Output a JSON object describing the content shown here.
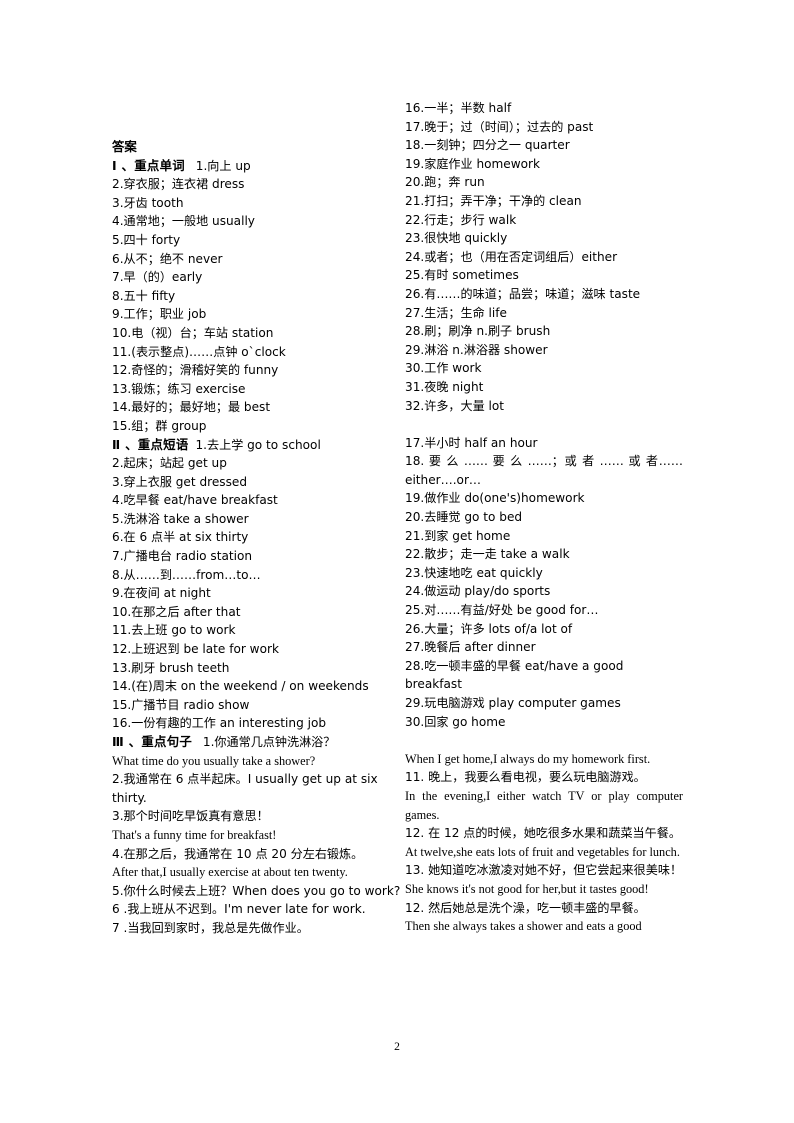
{
  "document": {
    "page_number": "2",
    "title": "答案"
  },
  "left_column": {
    "heading": "答案",
    "sections": [
      {
        "label": "Ⅰ 、重点单词",
        "first_item": "1.向上 up"
      }
    ],
    "lines": [
      "2.穿衣服；连衣裙 dress",
      "3.牙齿 tooth",
      "4.通常地；一般地 usually",
      "5.四十 forty",
      "6.从不；绝不 never",
      "7.早（的）early",
      "8.五十 fifty",
      "9.工作；职业 job",
      "10.电（视）台；车站 station",
      "11.(表示整点)……点钟 o`clock",
      "12.奇怪的；滑稽好笑的 funny",
      "13.锻炼；练习 exercise",
      "14.最好的；最好地；最 best",
      "15.组；群 group"
    ],
    "section2": {
      "label": "Ⅱ 、重点短语",
      "first_item": "1.去上学 go to school",
      "lines": [
        "2.起床；站起 get up",
        "3.穿上衣服 get dressed",
        "4.吃早餐 eat/have breakfast",
        "5.洗淋浴 take a shower",
        "6.在 6 点半 at six thirty",
        "7.广播电台 radio station",
        "8.从……到……from…to…",
        "9.在夜间 at night",
        "10.在那之后 after that",
        "11.去上班 go to work",
        "12.上班迟到 be late for work",
        "13.刷牙 brush teeth",
        "14.(在)周末 on the weekend / on weekends",
        "15.广播节目 radio show",
        "16.一份有趣的工作 an interesting job"
      ]
    },
    "section3": {
      "label": "Ⅲ 、重点句子",
      "first_item": "1.你通常几点钟洗淋浴？",
      "lines": [
        "What time do you usually take a shower?",
        "2.我通常在 6 点半起床。I usually get up at six thirty.",
        "3.那个时间吃早饭真有意思！",
        "That's a funny time for breakfast!",
        "4.在那之后，我通常在 10 点 20 分左右锻炼。",
        "After that,I usually exercise at about ten twenty.",
        "5.你什么时候去上班？When does you go to work?",
        "6 .我上班从不迟到。I'm never late for work.",
        "7 .当我回到家时，我总是先做作业。"
      ]
    }
  },
  "right_column": {
    "words": [
      "16.一半；半数 half",
      "17.晚于；过（时间）；过去的 past",
      "18.一刻钟；四分之一 quarter",
      "19.家庭作业 homework",
      "20.跑；奔 run",
      "21.打扫；弄干净；干净的 clean",
      "22.行走；步行 walk",
      "23.很快地 quickly",
      "24.或者；也（用在否定词组后）either",
      "25.有时 sometimes",
      "26.有……的味道；品尝；味道；滋味 taste",
      "27.生活；生命 life",
      "28.刷；刷净 n.刷子 brush",
      "29.淋浴 n.淋浴器 shower",
      "30.工作 work",
      "31.夜晚 night",
      "32.许多，大量 lot"
    ],
    "phrases_first": "17.半小时 half an hour",
    "phrase_justified": "18. 要 么 …… 要 么 ……；或 者 …… 或 者……either….or…",
    "phrases": [
      "19.做作业 do(one's)homework",
      "20.去睡觉 go to bed",
      "21.到家 get home",
      "22.散步；走一走 take a walk",
      "23.快速地吃 eat quickly",
      "24.做运动 play/do sports",
      "25.对……有益/好处 be good for…",
      "26.大量；许多 lots of/a lot of",
      "27.晚餐后 after dinner",
      "28.吃一顿丰盛的早餐 eat/have a good breakfast",
      "29.玩电脑游戏 play computer games",
      "30.回家 go home"
    ],
    "sentences": [
      "When I get home,I always do my homework first.",
      "11. 晚上，我要么看电视，要么玩电脑游戏。"
    ],
    "sentence_justified_1": "In the evening,I either watch TV or play computer games.",
    "sentences2": [
      "12. 在 12 点的时候，她吃很多水果和蔬菜当午餐。",
      "At twelve,she eats lots of fruit and vegetables for lunch.",
      "13. 她知道吃冰激凌对她不好，但它尝起来很美味！",
      "She knows it's not good for her,but it tastes good!",
      "12. 然后她总是洗个澡，吃一顿丰盛的早餐。"
    ],
    "sentence_justified_2": "Then she always takes a shower and eats a good"
  }
}
